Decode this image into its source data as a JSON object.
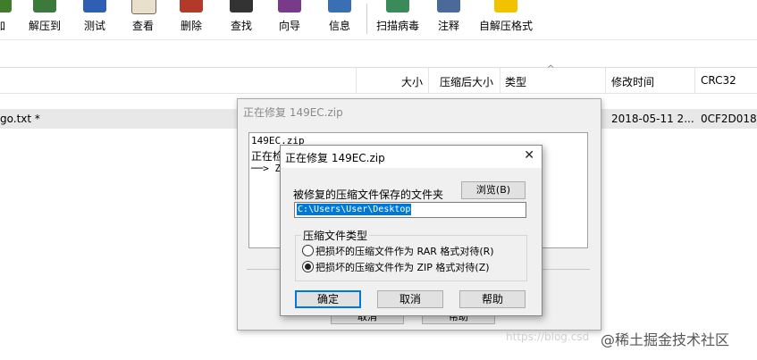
{
  "toolbar": {
    "items": [
      {
        "label": "加",
        "icon": "add-icon",
        "color": "#3f7d2a"
      },
      {
        "label": "解压到",
        "icon": "extract-to-icon",
        "color": "#3b7a3a"
      },
      {
        "label": "测试",
        "icon": "test-icon",
        "color": "#2f5fb3"
      },
      {
        "label": "查看",
        "icon": "view-book-icon",
        "color": "#7a6a50"
      },
      {
        "label": "删除",
        "icon": "delete-icon",
        "color": "#b33a2a"
      },
      {
        "label": "查找",
        "icon": "binoculars-icon",
        "color": "#333333"
      },
      {
        "label": "向导",
        "icon": "wizard-icon",
        "color": "#7a3a8a"
      },
      {
        "label": "信息",
        "icon": "info-icon",
        "color": "#3a6fb3"
      },
      {
        "label": "扫描病毒",
        "icon": "virus-scan-icon",
        "color": "#3a8a5a"
      },
      {
        "label": "注释",
        "icon": "comment-icon",
        "color": "#4a6a9a"
      },
      {
        "label": "自解压格式",
        "icon": "sfx-icon",
        "color": "#d9a400"
      }
    ]
  },
  "columns": {
    "size": "大小",
    "packed": "压缩后大小",
    "type": "类型",
    "modified": "修改时间",
    "crc": "CRC32"
  },
  "file_row": {
    "name": "go.txt *",
    "modified": "2018-05-11 2...",
    "crc": "0CF2D018"
  },
  "outer_dialog": {
    "title": "正在修复 149EC.zip",
    "log": [
      "149EC.zip",
      "正在检",
      "──> Z"
    ],
    "buttons": [
      "取消",
      "帮助"
    ]
  },
  "inner_dialog": {
    "title": "正在修复 149EC.zip",
    "close": "✕",
    "path_label": "被修复的压缩文件保存的文件夹",
    "browse": "浏览(B)",
    "path_value": "C:\\Users\\User\\Desktop",
    "group_label": "压缩文件类型",
    "radios": [
      {
        "label": "把损坏的压缩文件作为 RAR 格式对待(R)",
        "checked": false
      },
      {
        "label": "把损坏的压缩文件作为 ZIP 格式对待(Z)",
        "checked": true
      }
    ],
    "ok": "确定",
    "cancel": "取消",
    "help": "帮助"
  },
  "watermark": {
    "url": "https://blog.csd",
    "text": "@稀土掘金技术社区"
  }
}
